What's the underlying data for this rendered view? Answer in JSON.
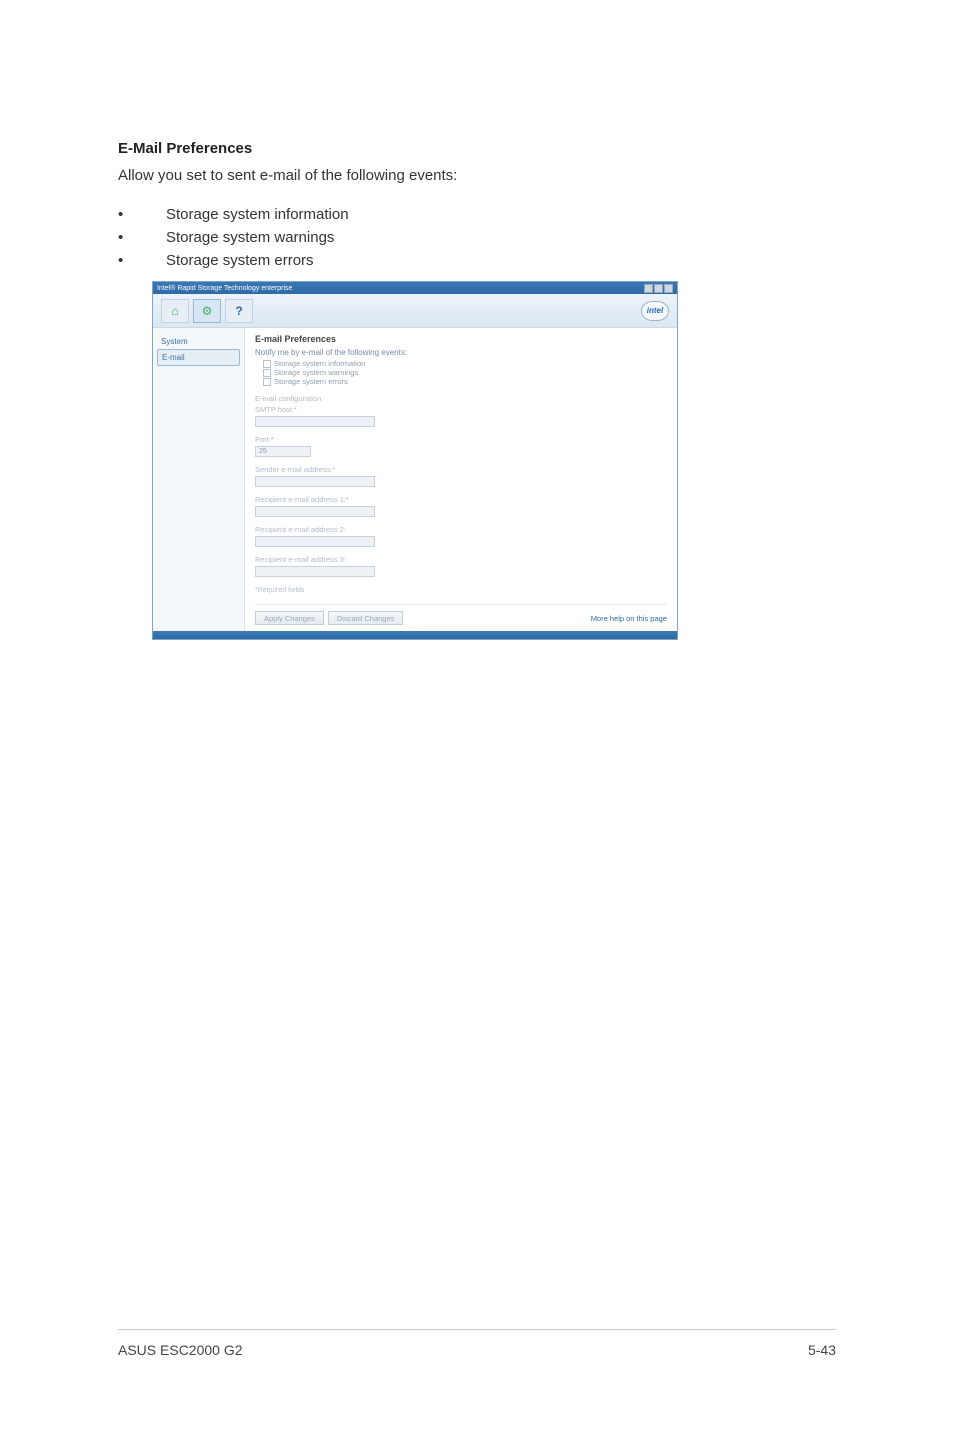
{
  "section_title": "E-Mail Preferences",
  "lead_text": "Allow you set to sent e-mail of the following events:",
  "bullets": [
    "Storage system information",
    "Storage system warnings",
    "Storage system errors"
  ],
  "window": {
    "title": "Intel® Rapid Storage Technology enterprise",
    "toolbar": {
      "home": "Home",
      "preferences": "Preferences"
    },
    "logo": "intel",
    "sidebar": {
      "items": [
        {
          "label": "System",
          "selected": false
        },
        {
          "label": "E-mail",
          "selected": true
        }
      ]
    },
    "pane": {
      "title": "E-mail Preferences",
      "notify_text": "Notify me by e-mail of the following events:",
      "checks": [
        "Storage system information",
        "Storage system warnings",
        "Storage system errors"
      ],
      "config_header": "E-mail configuration",
      "fields": {
        "smtp_label": "SMTP host:*",
        "port_label": "Port:*",
        "port_value": "25",
        "sender_label": "Sender e-mail address:*",
        "recip1_label": "Recipient e-mail address 1:*",
        "recip2_label": "Recipient e-mail address 2:",
        "recip3_label": "Recipient e-mail address 3:"
      },
      "required_note": "*Required fields",
      "buttons": {
        "apply": "Apply Changes",
        "discard": "Discard Changes"
      },
      "help_link": "More help on this page"
    }
  },
  "footer": {
    "left": "ASUS ESC2000 G2",
    "right": "5-43"
  }
}
